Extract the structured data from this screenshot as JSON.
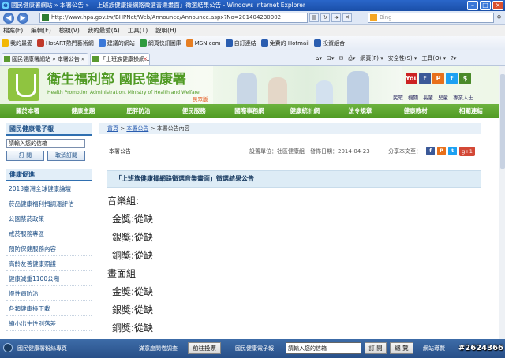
{
  "browser": {
    "window_title": "國民健康署網站 » 本署公告 » 「上班族健康操網路徵選音樂畫面」徵選結果公告 - Windows Internet Explorer",
    "url": "http://www.hpa.gov.tw/BHPNet/Web/Announce/Announce.aspx?No=201404230002",
    "search_placeholder": "Bing",
    "menu": [
      "檔案(F)",
      "編輯(E)",
      "檢視(V)",
      "我的最愛(A)",
      "工具(T)",
      "說明(H)"
    ],
    "favorites": [
      {
        "label": "我的最愛",
        "icon": "star-icon",
        "color": "#f2b705"
      },
      {
        "label": "HotART熱門藝術網",
        "icon": "site-icon",
        "color": "#c0392b"
      },
      {
        "label": "建議的網站",
        "icon": "ie-icon",
        "color": "#3b78d8"
      },
      {
        "label": "網頁快訊圖庫",
        "icon": "feed-icon",
        "color": "#2e9a3e"
      },
      {
        "label": "MSN.com",
        "icon": "msn-icon",
        "color": "#e67e22"
      },
      {
        "label": "自訂連結",
        "icon": "page-icon",
        "color": "#2a5db0"
      },
      {
        "label": "免費的 Hotmail",
        "icon": "page-icon",
        "color": "#2a5db0"
      },
      {
        "label": "投資組合",
        "icon": "page-icon",
        "color": "#2a5db0"
      }
    ],
    "tabs": [
      "國民健康署網站 » 本署公告 » 「上班族...",
      "「上班族健康操網..."
    ],
    "commands": [
      "網頁(P) ▾",
      "安全性(S) ▾",
      "工具(O) ▾"
    ]
  },
  "site": {
    "title": "衛生福利部 國民健康署",
    "subtitle": "Health Promotion Administration, Ministry of Health and Welfare",
    "badge": "民眾版",
    "social": [
      {
        "label": "You",
        "color": "#cc2222"
      },
      {
        "label": "f",
        "color": "#3b5998"
      },
      {
        "label": "P",
        "color": "#e8701a"
      },
      {
        "label": "t",
        "color": "#1da1f2"
      },
      {
        "label": "$",
        "color": "#4a8a2a"
      }
    ],
    "util_links": [
      "民眾",
      "機關",
      "長輩",
      "兒童",
      "專業人士"
    ],
    "nav": [
      "關於本署",
      "健康主題",
      "肥胖防治",
      "便民服務",
      "國際事務網",
      "健康統計網",
      "法令規章",
      "健康教材",
      "相關連結"
    ]
  },
  "sidebar": {
    "epaper_title": "國民健康電子報",
    "epaper_input": "請輸入您的信箱",
    "subscribe_label": "訂  閱",
    "unsubscribe_label": "取消訂閱",
    "promo_title": "健康促進",
    "items": [
      "2013臺灣全球健康論壇",
      "菸品健康福利捐調漲評估",
      "公園禁菸政策",
      "戒菸服務專區",
      "預防保健服務內容",
      "高齡友善健康照護",
      "健康減重1100公噸",
      "慢性病防治",
      "各類健康操下載",
      "縮小出生性別落差"
    ]
  },
  "content": {
    "breadcrumb": {
      "home": "首頁",
      "sep": ">",
      "section": "本署公告",
      "current": "本署公告內容"
    },
    "category": "本署公告",
    "meta": "設置單位：社區健康組　發佈日期：2014-04-23",
    "share_label": "分享本文至：",
    "gplus_label": "g+1",
    "announcement_title": "「上班族健康操網路徵選音樂畫面」徵選結果公告",
    "body_lines": [
      {
        "text": "音樂組:",
        "indent": false
      },
      {
        "text": "金獎:從缺",
        "indent": true
      },
      {
        "text": "銀獎:從缺",
        "indent": true
      },
      {
        "text": "銅獎:從缺",
        "indent": true
      },
      {
        "text": "畫面組",
        "indent": false
      },
      {
        "text": "金獎:從缺",
        "indent": true
      },
      {
        "text": "銀獎:從缺",
        "indent": true
      },
      {
        "text": "銅獎:從缺",
        "indent": true
      }
    ]
  },
  "bottom_bar": {
    "fans_label": "國民健康署粉絲專頁",
    "survey_label": "滿意度問卷調查",
    "survey_button": "前往投票",
    "epaper_label": "國民健康電子報",
    "epaper_input": "請輸入您的信箱",
    "subscribe_label": "訂 閱",
    "overview_label": "總 覽",
    "sitemap_label": "網站導覽"
  },
  "watermark": "#2624366"
}
